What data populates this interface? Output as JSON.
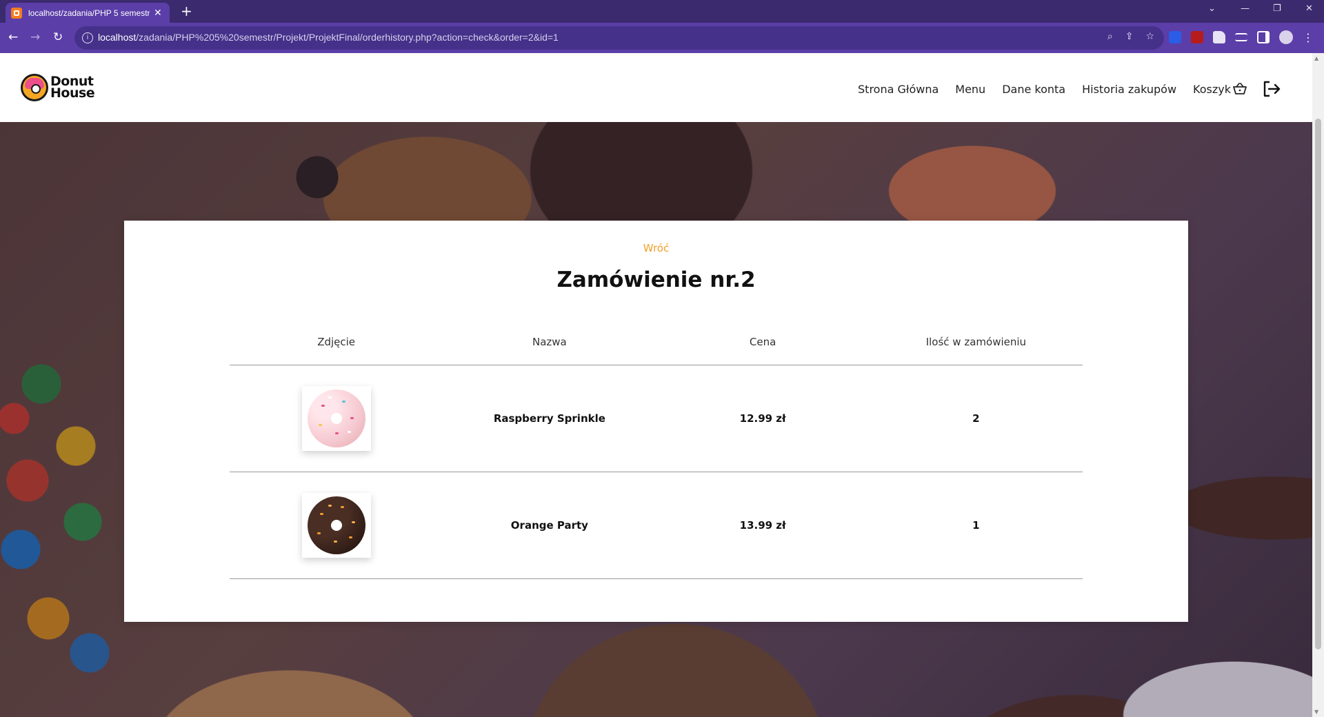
{
  "browser": {
    "tab_title": "localhost/zadania/PHP 5 semestr",
    "new_tab_label": "+",
    "url_host": "localhost",
    "url_path": "/zadania/PHP%205%20semestr/Projekt/ProjektFinal/orderhistory.php?action=check&order=2&id=1"
  },
  "site": {
    "logo_line1": "Donut",
    "logo_line2": "House",
    "nav": {
      "home": "Strona Główna",
      "menu": "Menu",
      "account": "Dane konta",
      "history": "Historia zakupów",
      "cart": "Koszyk"
    }
  },
  "order": {
    "back_label": "Wróć",
    "title": "Zamówienie nr.2",
    "columns": [
      "Zdjęcie",
      "Nazwa",
      "Cena",
      "Ilość w zamówieniu"
    ],
    "items": [
      {
        "name": "Raspberry Sprinkle",
        "price": "12.99 zł",
        "quantity": "2",
        "image": "pink-sprinkle-donut"
      },
      {
        "name": "Orange Party",
        "price": "13.99 zł",
        "quantity": "1",
        "image": "chocolate-orange-donut"
      }
    ]
  },
  "colors": {
    "browser_frame": "#3b2a6e",
    "browser_toolbar": "#5b3ea8",
    "accent_link": "#f0a028"
  }
}
